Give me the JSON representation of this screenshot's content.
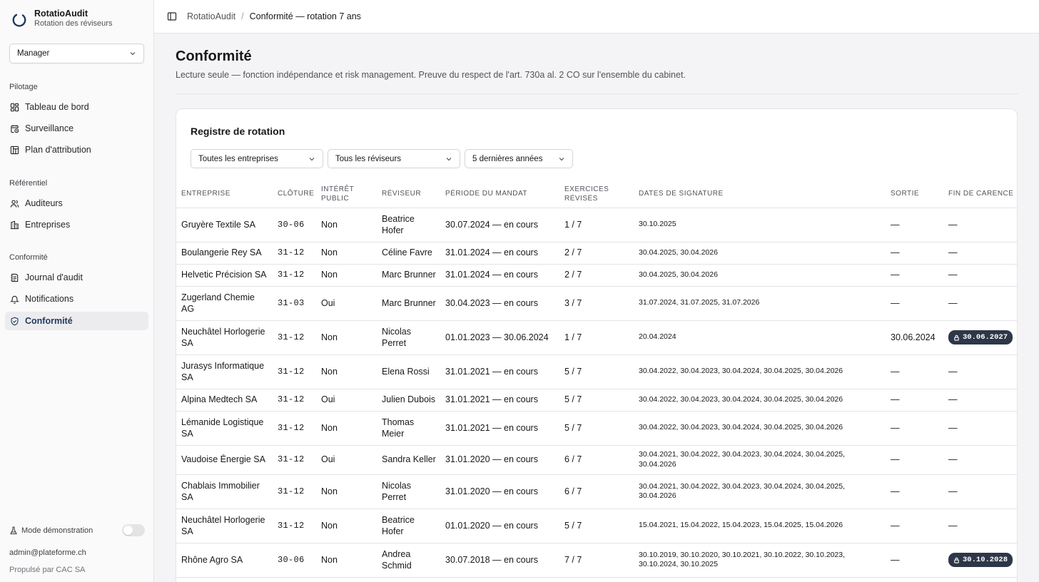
{
  "sidebar": {
    "brand_name": "RotatioAudit",
    "brand_sub": "Rotation des réviseurs",
    "role": "Manager",
    "groups": [
      {
        "label": "Pilotage"
      },
      {
        "label": "Référentiel"
      },
      {
        "label": "Conformité"
      }
    ],
    "items": [
      {
        "label": "Tableau de bord",
        "icon": "dashboard-icon"
      },
      {
        "label": "Surveillance",
        "icon": "calendar-clock-icon"
      },
      {
        "label": "Plan d'attribution",
        "icon": "plan-icon"
      },
      {
        "label": "Auditeurs",
        "icon": "users-icon"
      },
      {
        "label": "Entreprises",
        "icon": "building-icon"
      },
      {
        "label": "Journal d'audit",
        "icon": "log-icon"
      },
      {
        "label": "Notifications",
        "icon": "bell-icon"
      },
      {
        "label": "Conformité",
        "icon": "shield-check-icon",
        "active": true
      }
    ],
    "demo_label": "Mode démonstration",
    "demo_enabled": false,
    "email": "admin@plateforme.ch",
    "powered": "Propulsé par CAC SA"
  },
  "topbar": {
    "crumb_root": "RotatioAudit",
    "crumb_separator": "/",
    "crumb_current": "Conformité — rotation 7 ans"
  },
  "page": {
    "title": "Conformité",
    "subtitle": "Lecture seule — fonction indépendance et risk management. Preuve du respect de l'art. 730a al. 2 CO sur l'ensemble du cabinet."
  },
  "register": {
    "title": "Registre de rotation",
    "filters": [
      "Toutes les entreprises",
      "Tous les réviseurs",
      "5 dernières années"
    ],
    "columns": [
      "Entreprise",
      "Clôture",
      "Intérêt public",
      "Réviseur",
      "Période du mandat",
      "Exercices révisés",
      "Dates de signature",
      "Sortie",
      "Fin de carence"
    ],
    "rows": [
      {
        "company": "Gruyère Textile SA",
        "closing": "30-06",
        "public": "Non",
        "auditor": "Beatrice Hofer",
        "period": "30.07.2024 — en cours",
        "years": "1 / 7",
        "dates": "30.10.2025",
        "exit": "—",
        "end": "—",
        "end_badge": false
      },
      {
        "company": "Boulangerie Rey SA",
        "closing": "31-12",
        "public": "Non",
        "auditor": "Céline Favre",
        "period": "31.01.2024 — en cours",
        "years": "2 / 7",
        "dates": "30.04.2025, 30.04.2026",
        "exit": "—",
        "end": "—",
        "end_badge": false
      },
      {
        "company": "Helvetic Précision SA",
        "closing": "31-12",
        "public": "Non",
        "auditor": "Marc Brunner",
        "period": "31.01.2024 — en cours",
        "years": "2 / 7",
        "dates": "30.04.2025, 30.04.2026",
        "exit": "—",
        "end": "—",
        "end_badge": false
      },
      {
        "company": "Zugerland Chemie AG",
        "closing": "31-03",
        "public": "Oui",
        "auditor": "Marc Brunner",
        "period": "30.04.2023 — en cours",
        "years": "3 / 7",
        "dates": "31.07.2024, 31.07.2025, 31.07.2026",
        "exit": "—",
        "end": "—",
        "end_badge": false
      },
      {
        "company": "Neuchâtel Horlogerie SA",
        "closing": "31-12",
        "public": "Non",
        "auditor": "Nicolas Perret",
        "period": "01.01.2023 — 30.06.2024",
        "years": "1 / 7",
        "dates": "20.04.2024",
        "exit": "30.06.2024",
        "end": "30.06.2027",
        "end_badge": true
      },
      {
        "company": "Jurasys Informatique SA",
        "closing": "31-12",
        "public": "Non",
        "auditor": "Elena Rossi",
        "period": "31.01.2021 — en cours",
        "years": "5 / 7",
        "dates": "30.04.2022, 30.04.2023, 30.04.2024, 30.04.2025, 30.04.2026",
        "exit": "—",
        "end": "—",
        "end_badge": false
      },
      {
        "company": "Alpina Medtech SA",
        "closing": "31-12",
        "public": "Oui",
        "auditor": "Julien Dubois",
        "period": "31.01.2021 — en cours",
        "years": "5 / 7",
        "dates": "30.04.2022, 30.04.2023, 30.04.2024, 30.04.2025, 30.04.2026",
        "exit": "—",
        "end": "—",
        "end_badge": false
      },
      {
        "company": "Lémanide Logistique SA",
        "closing": "31-12",
        "public": "Non",
        "auditor": "Thomas Meier",
        "period": "31.01.2021 — en cours",
        "years": "5 / 7",
        "dates": "30.04.2022, 30.04.2023, 30.04.2024, 30.04.2025, 30.04.2026",
        "exit": "—",
        "end": "—",
        "end_badge": false
      },
      {
        "company": "Vaudoise Énergie SA",
        "closing": "31-12",
        "public": "Oui",
        "auditor": "Sandra Keller",
        "period": "31.01.2020 — en cours",
        "years": "6 / 7",
        "dates": "30.04.2021, 30.04.2022, 30.04.2023, 30.04.2024, 30.04.2025, 30.04.2026",
        "exit": "—",
        "end": "—",
        "end_badge": false
      },
      {
        "company": "Chablais Immobilier SA",
        "closing": "31-12",
        "public": "Non",
        "auditor": "Nicolas Perret",
        "period": "31.01.2020 — en cours",
        "years": "6 / 7",
        "dates": "30.04.2021, 30.04.2022, 30.04.2023, 30.04.2024, 30.04.2025, 30.04.2026",
        "exit": "—",
        "end": "—",
        "end_badge": false
      },
      {
        "company": "Neuchâtel Horlogerie SA",
        "closing": "31-12",
        "public": "Non",
        "auditor": "Beatrice Hofer",
        "period": "01.01.2020 — en cours",
        "years": "5 / 7",
        "dates": "15.04.2021, 15.04.2022, 15.04.2023, 15.04.2025, 15.04.2026",
        "exit": "—",
        "end": "—",
        "end_badge": false
      },
      {
        "company": "Rhône Agro SA",
        "closing": "30-06",
        "public": "Non",
        "auditor": "Andrea Schmid",
        "period": "30.07.2018 — en cours",
        "years": "7 / 7",
        "dates": "30.10.2019, 30.10.2020, 30.10.2021, 30.10.2022, 30.10.2023, 30.10.2024, 30.10.2025",
        "exit": "—",
        "end": "30.10.2028",
        "end_badge": true
      }
    ]
  }
}
